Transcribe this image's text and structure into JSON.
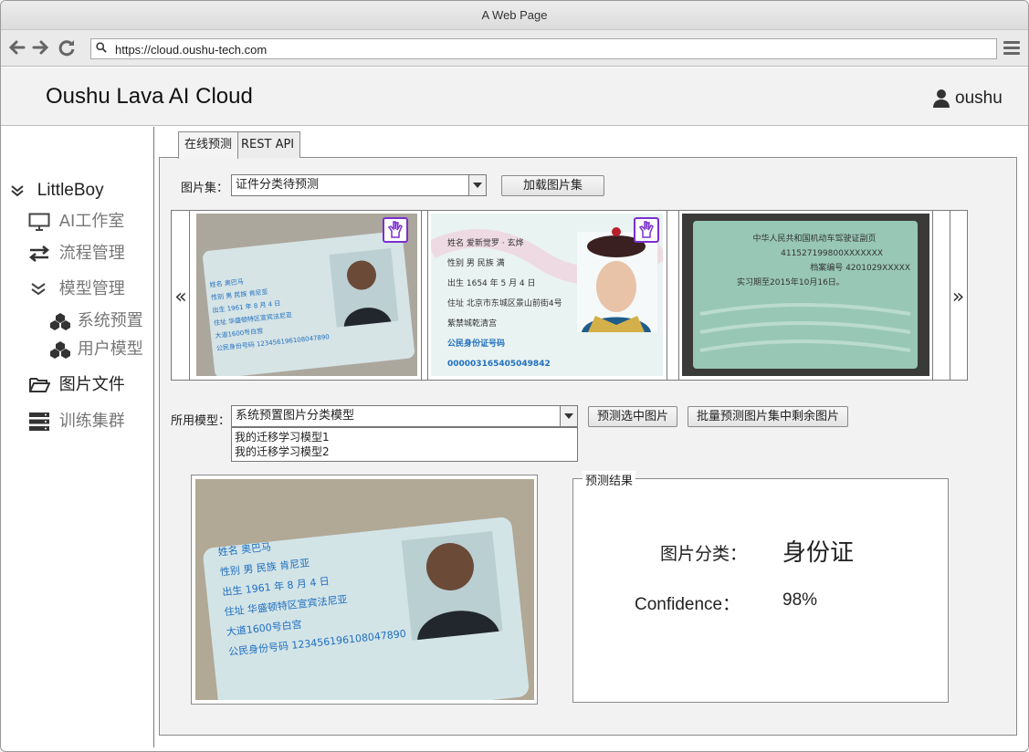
{
  "browser": {
    "window_title": "A Web Page",
    "url": "https://cloud.oushu-tech.com"
  },
  "header": {
    "app_title": "Oushu Lava AI Cloud",
    "username": "oushu"
  },
  "sidebar": {
    "root_label": "LittleBoy",
    "items": [
      {
        "label": "AI工作室"
      },
      {
        "label": "流程管理"
      },
      {
        "label": "模型管理"
      },
      {
        "label": "系统预置"
      },
      {
        "label": "用户模型"
      },
      {
        "label": "图片文件"
      },
      {
        "label": "训练集群"
      }
    ]
  },
  "tabs": [
    {
      "label": "在线预测",
      "active": true
    },
    {
      "label": "REST API",
      "active": false
    }
  ],
  "dataset": {
    "label": "图片集：",
    "selected": "证件分类待预测",
    "load_button": "加载图片集"
  },
  "carousel": {
    "prev": "«",
    "next": "»",
    "images": [
      {
        "name": "id-card-photo",
        "lines": [
          "姓名 奥巴马",
          "性别 男  民族 肯尼亚",
          "出生 1961 年 8 月 4 日",
          "住址 华盛顿特区宣宾法尼亚",
          "大道1600号白宫",
          "公民身份号码 123456196108047890"
        ],
        "selected": true
      },
      {
        "name": "id-card-scan",
        "lines": [
          "姓名 爱新觉罗 · 玄烨",
          "性别 男  民族 满",
          "出生 1654 年 5 月 4 日",
          "住址 北京市东城区景山前街4号",
          "紫禁城乾清宫",
          "公民身份证号码 000003165405049842"
        ],
        "selected": true
      },
      {
        "name": "driver-license-photo",
        "lines": [
          "中华人民共和国机动车驾驶证副页",
          "411527199800XXXXXXX",
          "档案编号 4201029XXXXX",
          "实习期至2015年10月16日。"
        ],
        "selected": false
      }
    ]
  },
  "model": {
    "label": "所用模型：",
    "selected": "系统预置图片分类模型",
    "options": [
      "我的迁移学习模型1",
      "我的迁移学习模型2"
    ],
    "predict_selected_button": "预测选中图片",
    "predict_batch_button": "批量预测图片集中剩余图片"
  },
  "preview": {
    "lines": [
      "姓名 奥巴马",
      "性别 男  民族 肯尼亚",
      "出生 1961 年 8 月 4 日",
      "住址 华盛顿特区宣宾法尼亚",
      "大道1600号白宫",
      "公民身份号码 123456196108047890"
    ]
  },
  "result": {
    "legend": "预测结果",
    "class_label": "图片分类：",
    "class_value": "身份证",
    "confidence_label": "Confidence：",
    "confidence_value": "98%"
  },
  "colors": {
    "accent_purple": "#7a2fd0",
    "panel_bg": "#f2f2f2",
    "card_blue": "#1f6fbf"
  }
}
